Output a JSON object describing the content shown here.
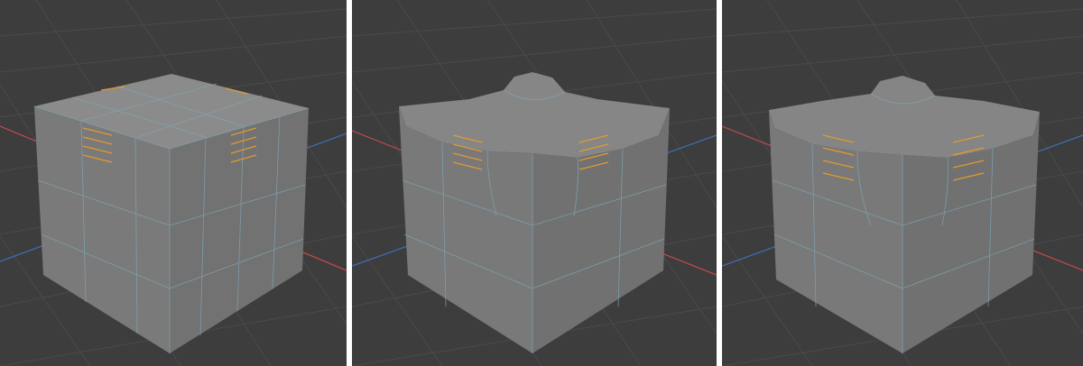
{
  "colors": {
    "background": "#3d3d3d",
    "grid": "#4a4a4a",
    "x_axis": "#c84a4a",
    "y_axis": "#3f6fb5",
    "mesh_face": "#7c7c7c",
    "mesh_edge": "#7ea7b8",
    "selected_edge": "#e39a2e",
    "separator": "#ffffff"
  },
  "viewports": [
    {
      "id": "viewport-1",
      "shape": "cube-unmodified"
    },
    {
      "id": "viewport-2",
      "shape": "cube-top-extruded-bump"
    },
    {
      "id": "viewport-3",
      "shape": "cube-top-beveled-bump"
    }
  ],
  "icons": [
    "grid-floor",
    "x-axis-line",
    "y-axis-line",
    "mesh-cube",
    "selected-edge-marks"
  ]
}
